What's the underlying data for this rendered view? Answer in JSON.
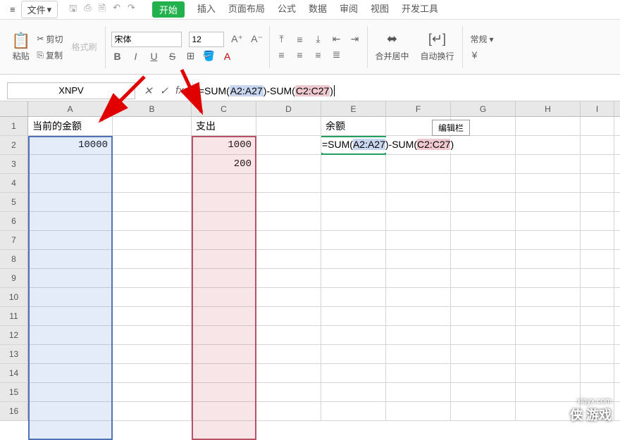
{
  "menubar": {
    "file": "文件",
    "tabs": [
      "开始",
      "插入",
      "页面布局",
      "公式",
      "数据",
      "审阅",
      "视图",
      "开发工具"
    ],
    "active_tab_index": 0
  },
  "ribbon": {
    "paste": "粘贴",
    "cut": "剪切",
    "copy": "复制",
    "format_painter": "格式刷",
    "font_name": "宋体",
    "font_size": "12",
    "merge_center": "合并居中",
    "wrap_text": "自动换行",
    "number_format": "常规"
  },
  "formula_bar": {
    "name_box": "XNPV",
    "formula_prefix": "=SUM(",
    "range_a": "A2:A27",
    "mid": ")-SUM(",
    "range_c": "C2:C27",
    "suffix": ")"
  },
  "tooltip": "编辑栏",
  "sheet": {
    "columns": [
      "A",
      "B",
      "C",
      "D",
      "E",
      "F",
      "G",
      "H",
      "I"
    ],
    "headers": {
      "A": "当前的金额",
      "C": "支出",
      "E": "余额"
    },
    "data": {
      "A2": "10000",
      "C2": "1000",
      "C3": "200"
    },
    "cell_edit_prefix": "=SUM(",
    "cell_edit_ra": "A2:A27",
    "cell_edit_mid": ")-SUM(",
    "cell_edit_rc": "C2:C27",
    "cell_edit_suffix": ")",
    "row_count": 16
  },
  "annotations": {
    "highlight_a": "A2:A27",
    "highlight_c": "C2:C27",
    "active_cell": "E2"
  },
  "watermark": {
    "brand": "侠 游戏",
    "url": "xiayx.com"
  }
}
